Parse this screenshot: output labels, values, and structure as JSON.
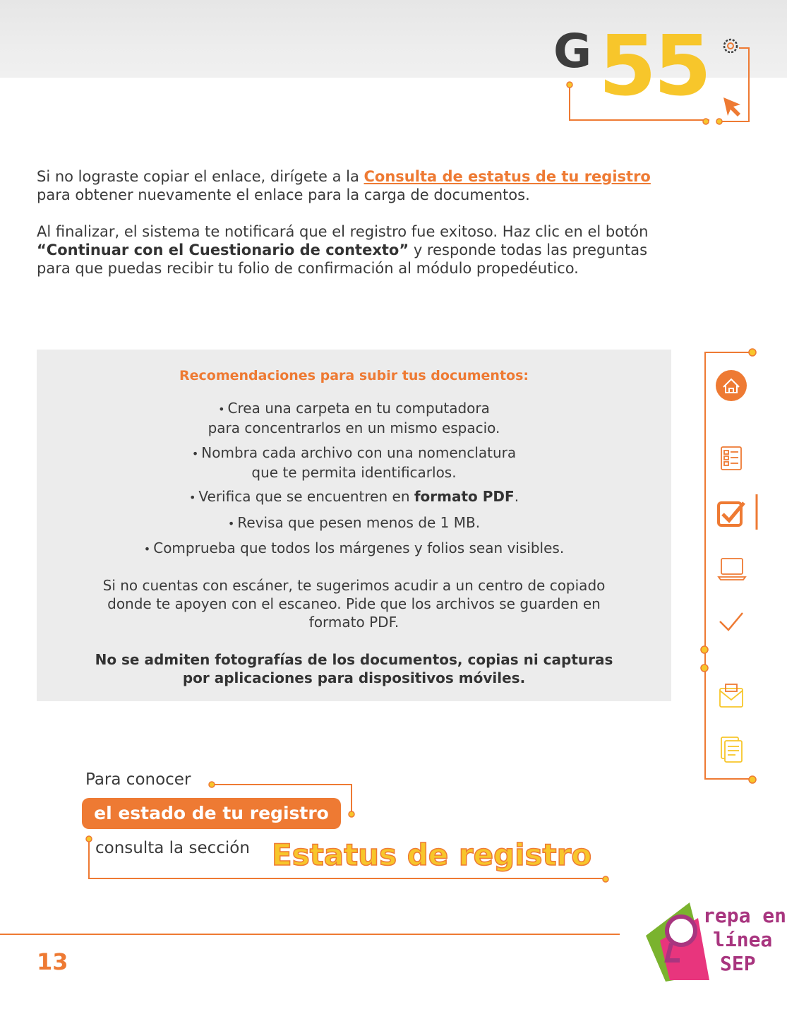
{
  "header": {
    "letter": "G",
    "number": "55"
  },
  "intro": {
    "p1_before": "Si no lograste copiar el enlace, dirígete a la ",
    "p1_link": "Consulta de estatus de tu registro",
    "p1_after": "para obtener nuevamente el enlace para la carga de documentos.",
    "p2_before": "Al finalizar, el sistema te notificará que el registro fue exitoso. Haz clic en el botón",
    "p2_bold": "“Continuar con el Cuestionario de contexto”",
    "p2_after": " y responde todas las preguntas",
    "p2_last": "para que puedas recibir tu folio de confirmación al módulo propedéutico."
  },
  "recommendations": {
    "title": "Recomendaciones para subir tus documentos:",
    "items": [
      {
        "line1": "Crea una carpeta en tu computadora",
        "line2": "para concentrarlos en un mismo espacio."
      },
      {
        "line1": "Nombra cada archivo con una nomenclatura",
        "line2": "que te permita identificarlos."
      },
      {
        "before": "Verifica que se encuentren en ",
        "bold": "formato PDF",
        "after": "."
      },
      {
        "line1": "Revisa que pesen menos de 1 MB."
      },
      {
        "line1": "Comprueba que todos los márgenes y folios sean visibles."
      }
    ],
    "scanner_l1": "Si no cuentas con escáner, te sugerimos acudir a un centro de copiado",
    "scanner_l2": "donde te apoyen con el escaneo. Pide que los archivos se guarden en",
    "scanner_l3": "formato PDF.",
    "warning_l1": "No se admiten fotografías de los documentos, copias ni capturas",
    "warning_l2": "por aplicaciones para dispositivos móviles."
  },
  "callout": {
    "line1": "Para conocer",
    "pill": "el estado de tu registro",
    "line3": "consulta la sección",
    "highlight": "Estatus de registro"
  },
  "footer": {
    "page_number": "13"
  },
  "logo": {
    "l1": "repa en",
    "l2": "línea",
    "l3": "SEP"
  },
  "colors": {
    "accent": "#ee7a33",
    "yellow": "#f7c62b",
    "text": "#3a3a3a",
    "box": "#ececec",
    "logo_purple": "#a8357f",
    "logo_green": "#7ab32e",
    "logo_pink": "#e8357d"
  },
  "sidebar_icons": [
    "home-icon",
    "form-icon",
    "checkbox-icon",
    "laptop-icon",
    "check-icon",
    "mail-icon",
    "documents-icon"
  ]
}
